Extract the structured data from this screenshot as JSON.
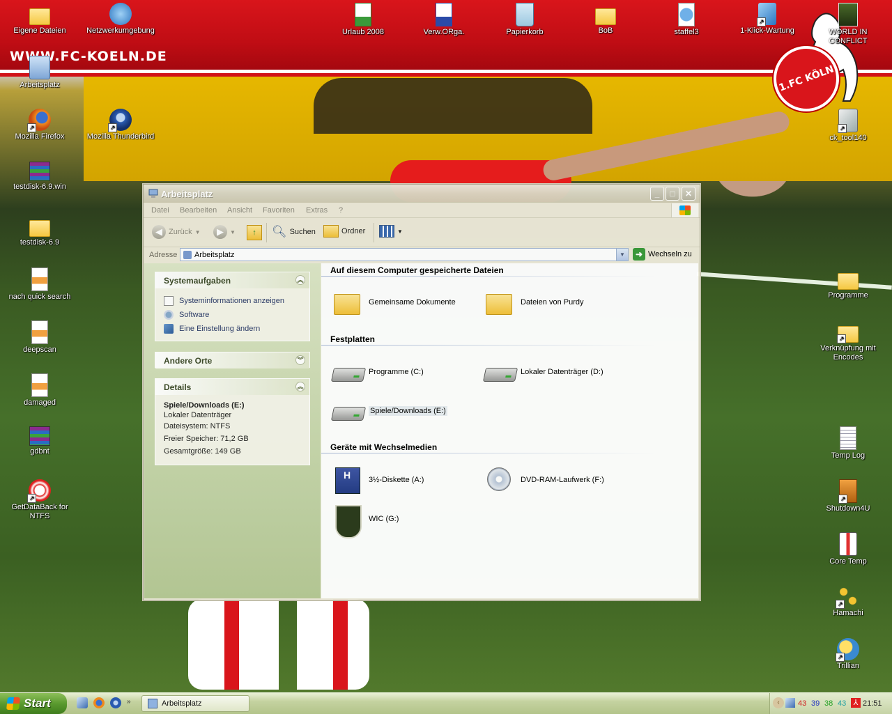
{
  "desktop": {
    "site_url": "WWW.FC-KOELN.DE",
    "club_logo_text": "1.FC KÖLN",
    "icons_top": [
      {
        "label": "Eigene Dateien",
        "icon": "my-documents-icon"
      },
      {
        "label": "Netzwerkumgebung",
        "icon": "network-icon"
      },
      {
        "label": "Urlaub 2008",
        "icon": "excel-file-icon"
      },
      {
        "label": "Verw.ORga.",
        "icon": "word-file-icon"
      },
      {
        "label": "Papierkorb",
        "icon": "recycle-bin-icon"
      },
      {
        "label": "BoB",
        "icon": "folder-icon"
      },
      {
        "label": "staffel3",
        "icon": "media-file-icon"
      },
      {
        "label": "1-Klick-Wartung",
        "icon": "maintenance-icon"
      },
      {
        "label": "WORLD IN CONFLICT",
        "icon": "game-icon"
      }
    ],
    "icons_left": [
      {
        "label": "Arbeitsplatz",
        "icon": "my-computer-icon"
      },
      {
        "label": "Mozilla Firefox",
        "icon": "firefox-icon"
      },
      {
        "label": "testdisk-6.9.win",
        "icon": "rar-archive-icon"
      },
      {
        "label": "testdisk-6.9",
        "icon": "folder-icon"
      },
      {
        "label": "nach quick search",
        "icon": "file-icon"
      },
      {
        "label": "deepscan",
        "icon": "file-icon"
      },
      {
        "label": "damaged",
        "icon": "file-icon"
      },
      {
        "label": "gdbnt",
        "icon": "rar-archive-icon"
      },
      {
        "label": "GetDataBack for NTFS",
        "icon": "lifebuoy-icon"
      }
    ],
    "icon_thunderbird": {
      "label": "Mozilla Thunderbird",
      "icon": "thunderbird-icon"
    },
    "icons_right": [
      {
        "label": "ck_tool140",
        "icon": "tool-icon"
      },
      {
        "label": "Programme",
        "icon": "folder-icon"
      },
      {
        "label": "Verknüpfung mit Encodes",
        "icon": "folder-shortcut-icon"
      },
      {
        "label": "Temp Log",
        "icon": "text-file-icon"
      },
      {
        "label": "Shutdown4U",
        "icon": "shutdown-icon"
      },
      {
        "label": "Core Temp",
        "icon": "thermometer-icon"
      },
      {
        "label": "Hamachi",
        "icon": "hamachi-icon"
      },
      {
        "label": "Trillian",
        "icon": "trillian-icon"
      }
    ]
  },
  "window": {
    "title": "Arbeitsplatz",
    "menu": [
      "Datei",
      "Bearbeiten",
      "Ansicht",
      "Favoriten",
      "Extras",
      "?"
    ],
    "toolbar": {
      "back": "Zurück",
      "search": "Suchen",
      "folders": "Ordner"
    },
    "address": {
      "label": "Adresse",
      "value": "Arbeitsplatz",
      "go": "Wechseln zu"
    },
    "left": {
      "system_tasks": {
        "title": "Systemaufgaben",
        "items": [
          "Systeminformationen anzeigen",
          "Software",
          "Eine Einstellung ändern"
        ]
      },
      "other_places": {
        "title": "Andere Orte"
      },
      "details": {
        "title": "Details",
        "name": "Spiele/Downloads (E:)",
        "type": "Lokaler Datenträger",
        "filesystem": "Dateisystem: NTFS",
        "free": "Freier Speicher: 71,2 GB",
        "total": "Gesamtgröße: 149 GB"
      }
    },
    "right": {
      "sections": [
        {
          "title": "Auf diesem Computer gespeicherte Dateien",
          "items": [
            "Gemeinsame Dokumente",
            "Dateien von Purdy"
          ]
        },
        {
          "title": "Festplatten",
          "items": [
            "Programme (C:)",
            "Lokaler Datenträger (D:)",
            "Spiele/Downloads (E:)"
          ]
        },
        {
          "title": "Geräte mit Wechselmedien",
          "items": [
            "3½-Diskette (A:)",
            "DVD-RAM-Laufwerk (F:)",
            "WIC (G:)"
          ]
        }
      ]
    }
  },
  "taskbar": {
    "start": "Start",
    "task": "Arbeitsplatz",
    "tray_numbers": [
      {
        "value": "43",
        "color": "#d02020"
      },
      {
        "value": "39",
        "color": "#2030c0"
      },
      {
        "value": "38",
        "color": "#20a020"
      },
      {
        "value": "43",
        "color": "#20a0a0"
      }
    ],
    "clock": "21:51"
  }
}
